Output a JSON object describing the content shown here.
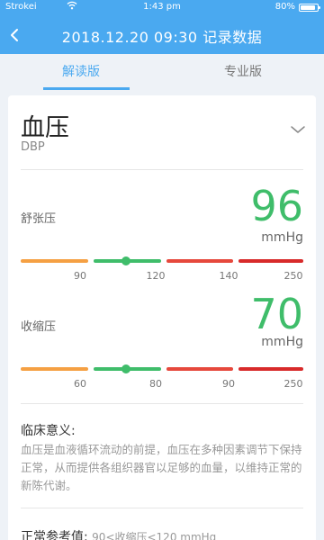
{
  "status_bar": {
    "carrier": "Strokei",
    "time": "1:43 pm",
    "battery": "80%",
    "battery_level": 0.8,
    "wifi_icon": "wifi-icon"
  },
  "header": {
    "title": "2018.12.20 09:30 记录数据",
    "back_icon": "chevron-left-icon",
    "color": "#4aa9f0"
  },
  "tabs": [
    {
      "label": "解读版",
      "active": true
    },
    {
      "label": "专业版",
      "active": false
    }
  ],
  "card": {
    "title": "血压",
    "subtitle": "DBP",
    "expand_icon": "chevron-down-icon"
  },
  "metrics": [
    {
      "label": "舒张压",
      "value": "96",
      "unit": "mmHg",
      "ticks": [
        "90",
        "120",
        "140",
        "250"
      ],
      "indicator_segment": 1
    },
    {
      "label": "收缩压",
      "value": "70",
      "unit": "mmHg",
      "ticks": [
        "60",
        "80",
        "90",
        "250"
      ],
      "indicator_segment": 1
    }
  ],
  "clinical": {
    "heading": "临床意义:",
    "body": "血压是血液循环流动的前提，血压在多种因素调节下保持正常，从而提供各组织器官以足够的血量，以维持正常的新陈代谢。"
  },
  "reference": {
    "label": "正常参考值:",
    "value": "90<收缩压<120 mmHg"
  },
  "colors": {
    "good": "#3fbd6a",
    "low": "#f5a043",
    "high": "#e6483c",
    "very_high": "#d82a2a"
  }
}
